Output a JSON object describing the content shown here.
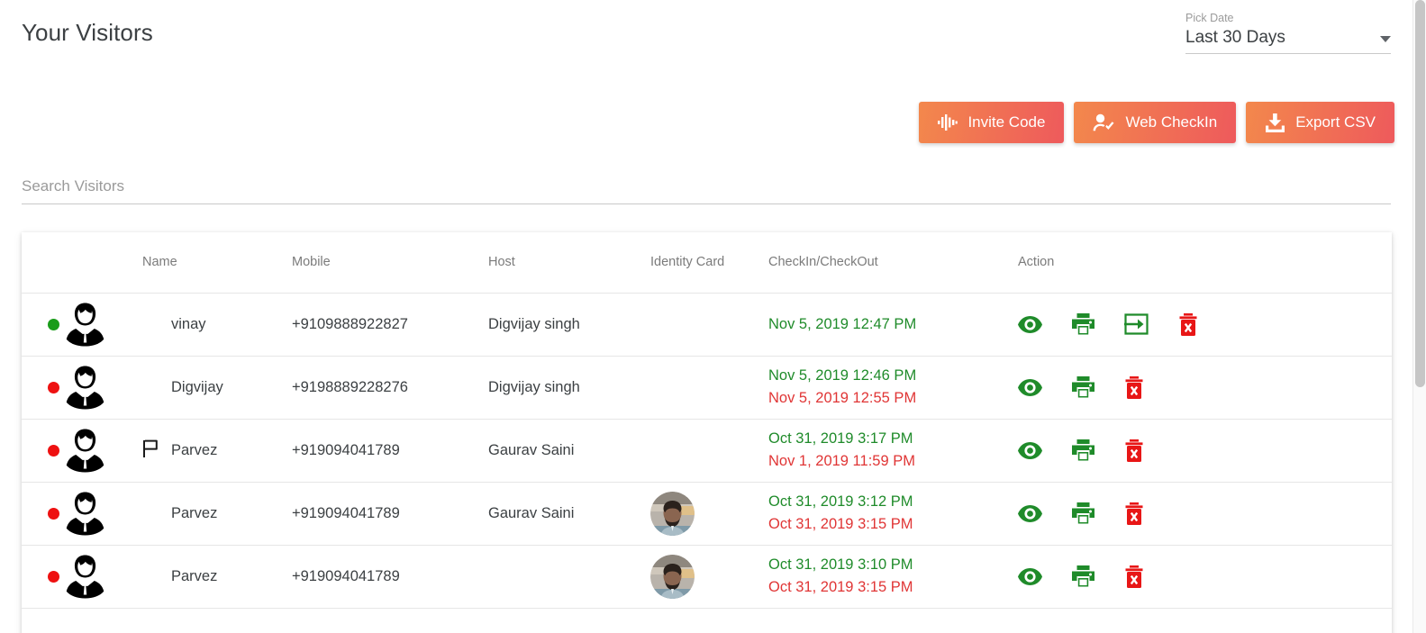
{
  "header": {
    "title": "Your Visitors",
    "date_picker": {
      "label": "Pick Date",
      "value": "Last 30 Days",
      "caret_icon": "chevron-down-icon"
    }
  },
  "toolbar": {
    "buttons": [
      {
        "label": "Invite Code",
        "icon": "sound-wave-icon"
      },
      {
        "label": "Web CheckIn",
        "icon": "user-check-icon"
      },
      {
        "label": "Export CSV",
        "icon": "download-icon"
      }
    ],
    "gradient_from": "#f3884c",
    "gradient_to": "#ee5a5c"
  },
  "search": {
    "placeholder": "Search Visitors",
    "value": ""
  },
  "table": {
    "columns": [
      {
        "key": "status",
        "label": ""
      },
      {
        "key": "avatar",
        "label": ""
      },
      {
        "key": "name",
        "label": "Name"
      },
      {
        "key": "mobile",
        "label": "Mobile"
      },
      {
        "key": "host",
        "label": "Host"
      },
      {
        "key": "identity",
        "label": "Identity Card"
      },
      {
        "key": "checkin",
        "label": "CheckIn/CheckOut"
      },
      {
        "key": "action",
        "label": "Action"
      }
    ],
    "status_colors": {
      "checked_in": "#1a9c1a",
      "checked_out": "#ee1111"
    },
    "action_colors": {
      "view": "#1f8b2a",
      "print": "#1f8b2a",
      "checkout": "#1f8b2a",
      "delete": "#e81616"
    },
    "rows": [
      {
        "status": "green",
        "avatar_icon": "user-avatar-icon",
        "flagged": false,
        "name": "vinay",
        "mobile": "+9109888922827",
        "host": "Digvijay singh",
        "identity_photo": false,
        "checkin": "Nov 5, 2019 12:47 PM",
        "checkout": "",
        "actions": [
          "view-icon",
          "print-icon",
          "checkout-icon",
          "delete-icon"
        ]
      },
      {
        "status": "red",
        "avatar_icon": "user-avatar-icon",
        "flagged": false,
        "name": "Digvijay",
        "mobile": "+9198889228276",
        "host": "Digvijay singh",
        "identity_photo": false,
        "checkin": "Nov 5, 2019 12:46 PM",
        "checkout": "Nov 5, 2019 12:55 PM",
        "actions": [
          "view-icon",
          "print-icon",
          "delete-icon"
        ]
      },
      {
        "status": "red",
        "avatar_icon": "user-avatar-icon",
        "flagged": true,
        "name": "Parvez",
        "mobile": "+919094041789",
        "host": "Gaurav Saini",
        "identity_photo": false,
        "checkin": "Oct 31, 2019 3:17 PM",
        "checkout": "Nov 1, 2019 11:59 PM",
        "actions": [
          "view-icon",
          "print-icon",
          "delete-icon"
        ]
      },
      {
        "status": "red",
        "avatar_icon": "user-avatar-icon",
        "flagged": false,
        "name": "Parvez",
        "mobile": "+919094041789",
        "host": "Gaurav Saini",
        "identity_photo": true,
        "checkin": "Oct 31, 2019 3:12 PM",
        "checkout": "Oct 31, 2019 3:15 PM",
        "actions": [
          "view-icon",
          "print-icon",
          "delete-icon"
        ]
      },
      {
        "status": "red",
        "avatar_icon": "user-avatar-icon",
        "flagged": false,
        "name": "Parvez",
        "mobile": "+919094041789",
        "host": "",
        "identity_photo": true,
        "checkin": "Oct 31, 2019 3:10 PM",
        "checkout": "Oct 31, 2019 3:15 PM",
        "actions": [
          "view-icon",
          "print-icon",
          "delete-icon"
        ]
      }
    ]
  }
}
